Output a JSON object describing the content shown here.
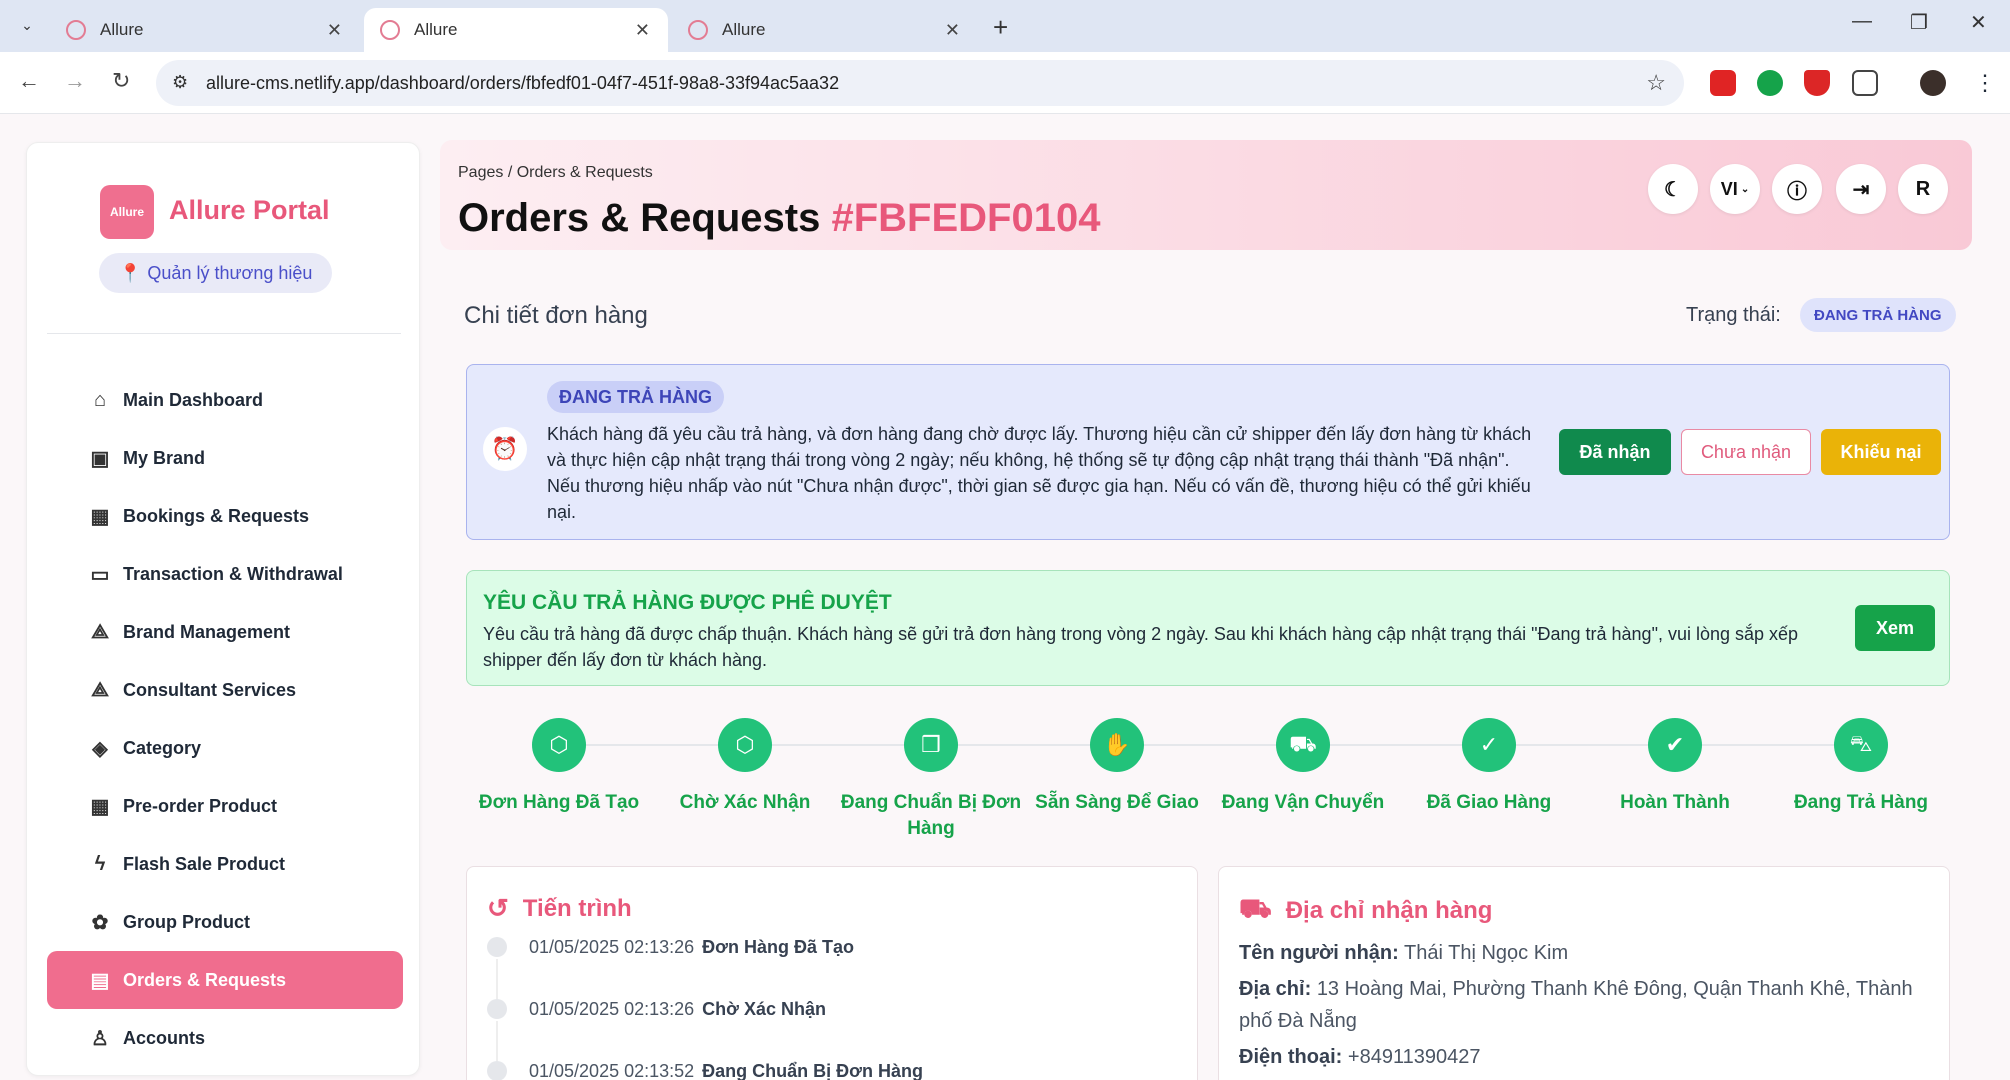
{
  "browser": {
    "tabs": [
      {
        "title": "Allure"
      },
      {
        "title": "Allure"
      },
      {
        "title": "Allure"
      }
    ],
    "url": "allure-cms.netlify.app/dashboard/orders/fbfedf01-04f7-451f-98a8-33f94ac5aa32"
  },
  "sidebar": {
    "logo_text": "Allure",
    "brand": "Allure Portal",
    "role": "Quản lý thương hiệu",
    "items": [
      {
        "label": "Main Dashboard",
        "icon": "home-icon"
      },
      {
        "label": "My Brand",
        "icon": "badge-icon"
      },
      {
        "label": "Bookings & Requests",
        "icon": "calendar-icon"
      },
      {
        "label": "Transaction & Withdrawal",
        "icon": "wallet-icon"
      },
      {
        "label": "Brand Management",
        "icon": "brand-icon"
      },
      {
        "label": "Consultant Services",
        "icon": "consult-icon"
      },
      {
        "label": "Category",
        "icon": "layers-icon"
      },
      {
        "label": "Pre-order Product",
        "icon": "calendar-days-icon"
      },
      {
        "label": "Flash Sale Product",
        "icon": "bolt-icon"
      },
      {
        "label": "Group Product",
        "icon": "group-icon"
      },
      {
        "label": "Orders & Requests",
        "icon": "document-icon",
        "active": true
      },
      {
        "label": "Accounts",
        "icon": "user-icon"
      }
    ]
  },
  "header": {
    "breadcrumb": "Pages  /  Orders & Requests",
    "title": "Orders & Requests",
    "order_code": "#FBFEDF0104",
    "lang": "VI",
    "avatar": "R"
  },
  "detail": {
    "title": "Chi tiết đơn hàng",
    "status_label": "Trạng thái:",
    "status_value": "ĐANG TRẢ HÀNG"
  },
  "alert_returning": {
    "tag": "ĐANG TRẢ HÀNG",
    "text": "Khách hàng đã yêu cầu trả hàng, và đơn hàng đang chờ được lấy. Thương hiệu cần cử shipper đến lấy đơn hàng từ khách và thực hiện cập nhật trạng thái trong vòng 2 ngày; nếu không, hệ thống sẽ tự động cập nhật trạng thái thành \"Đã nhận\". Nếu thương hiệu nhấp vào nút \"Chưa nhận được\", thời gian sẽ được gia hạn. Nếu có vấn đề, thương hiệu có thể gửi khiếu nại.",
    "btn_received": "Đã nhận",
    "btn_not_received": "Chưa nhận",
    "btn_complaint": "Khiếu nại"
  },
  "alert_approved": {
    "title": "YÊU CẦU TRẢ HÀNG ĐƯỢC PHÊ DUYỆT",
    "text": "Yêu cầu trả hàng đã được chấp thuận. Khách hàng sẽ gửi trả đơn hàng trong vòng 2 ngày. Sau khi khách hàng cập nhật trạng thái \"Đang trả hàng\", vui lòng sắp xếp shipper đến lấy đơn từ khách hàng.",
    "btn_view": "Xem"
  },
  "steps": [
    {
      "label": "Đơn Hàng Đã Tạo",
      "icon": "box-icon"
    },
    {
      "label": "Chờ Xác Nhận",
      "icon": "box-icon"
    },
    {
      "label": "Đang Chuẩn Bị Đơn Hàng",
      "icon": "package-icon"
    },
    {
      "label": "Sẵn Sàng Để Giao",
      "icon": "hand-icon"
    },
    {
      "label": "Đang Vận Chuyển",
      "icon": "truck-icon"
    },
    {
      "label": "Đã Giao Hàng",
      "icon": "check-circle-icon"
    },
    {
      "label": "Hoàn Thành",
      "icon": "check-icon"
    },
    {
      "label": "Đang Trả Hàng",
      "icon": "car-icon"
    }
  ],
  "timeline": {
    "title": "Tiến trình",
    "events": [
      {
        "time": "01/05/2025 02:13:26",
        "label": "Đơn Hàng Đã Tạo"
      },
      {
        "time": "01/05/2025 02:13:26",
        "label": "Chờ Xác Nhận"
      },
      {
        "time": "01/05/2025 02:13:52",
        "label": "Đang Chuẩn Bị Đơn Hàng"
      }
    ]
  },
  "address": {
    "title": "Địa chỉ nhận hàng",
    "receiver_label": "Tên người nhận:",
    "receiver": "Thái Thị Ngọc Kim",
    "address_label": "Địa chỉ:",
    "address": "13 Hoàng Mai, Phường Thanh Khê Đông, Quận Thanh Khê, Thành phố Đà Nẵng",
    "phone_label": "Điện thoại:",
    "phone": "+84911390427"
  }
}
